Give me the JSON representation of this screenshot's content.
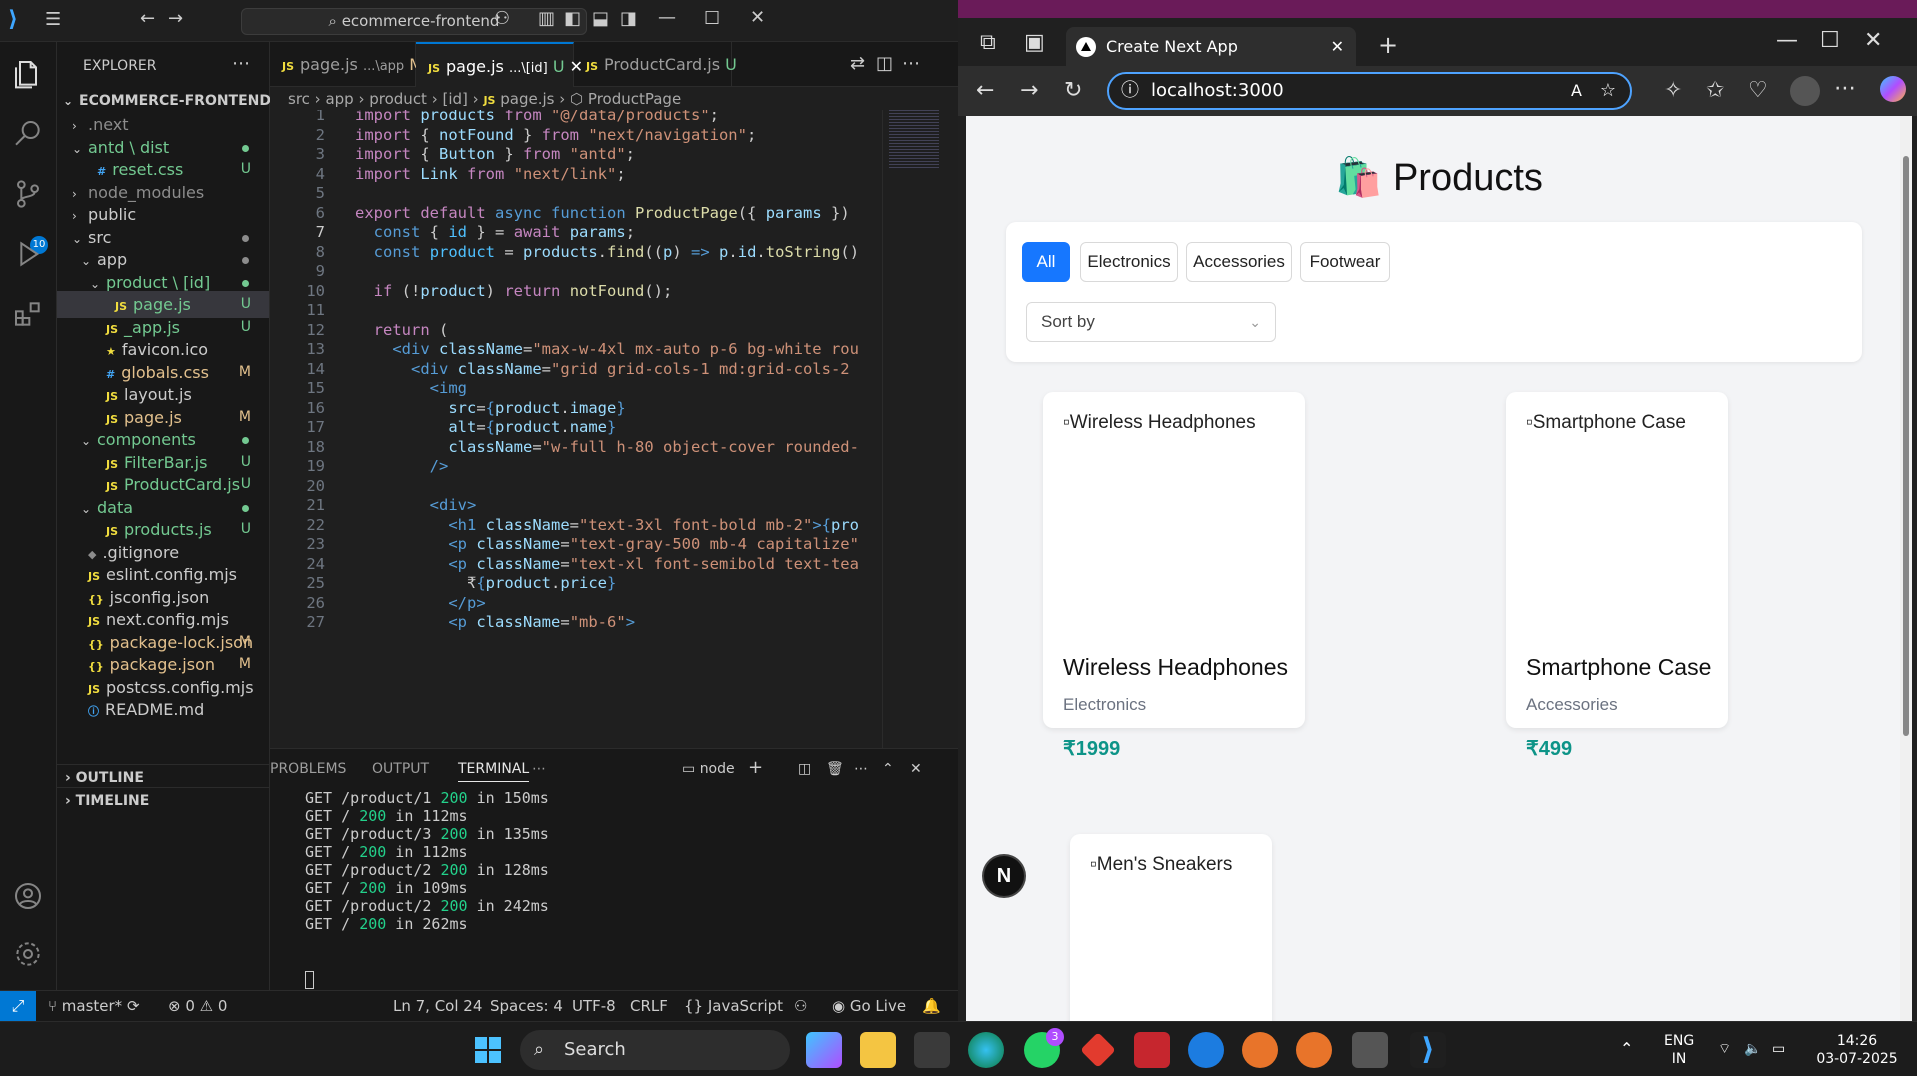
{
  "vscode": {
    "search_text": "ecommerce-frontend",
    "explorer_title": "EXPLORER",
    "project_name": "ECOMMERCE-FRONTEND",
    "scm_badge": "10",
    "tree": [
      {
        "label": ".next",
        "depth": 1,
        "type": "folder",
        "open": false,
        "status": "",
        "color": "grey"
      },
      {
        "label": "antd \\ dist",
        "depth": 1,
        "type": "folder",
        "open": true,
        "status": "dot",
        "color": "green"
      },
      {
        "label": "reset.css",
        "depth": 2,
        "type": "css",
        "status": "U",
        "color": "green"
      },
      {
        "label": "node_modules",
        "depth": 1,
        "type": "folder",
        "open": false,
        "status": "",
        "color": "grey"
      },
      {
        "label": "public",
        "depth": 1,
        "type": "folder",
        "open": false,
        "status": "",
        "color": "normal"
      },
      {
        "label": "src",
        "depth": 1,
        "type": "folder",
        "open": true,
        "status": "dot",
        "color": "normal"
      },
      {
        "label": "app",
        "depth": 2,
        "type": "folder",
        "open": true,
        "status": "dot",
        "color": "normal"
      },
      {
        "label": "product \\ [id]",
        "depth": 3,
        "type": "folder",
        "open": true,
        "status": "dot",
        "color": "green"
      },
      {
        "label": "page.js",
        "depth": 4,
        "type": "js",
        "status": "U",
        "color": "green",
        "selected": true
      },
      {
        "label": "_app.js",
        "depth": 3,
        "type": "js",
        "status": "U",
        "color": "green"
      },
      {
        "label": "favicon.ico",
        "depth": 3,
        "type": "ico",
        "status": "",
        "color": "normal"
      },
      {
        "label": "globals.css",
        "depth": 3,
        "type": "css",
        "status": "M",
        "color": "yellow"
      },
      {
        "label": "layout.js",
        "depth": 3,
        "type": "js",
        "status": "",
        "color": "normal"
      },
      {
        "label": "page.js",
        "depth": 3,
        "type": "js",
        "status": "M",
        "color": "yellow"
      },
      {
        "label": "components",
        "depth": 2,
        "type": "folder",
        "open": true,
        "status": "dot",
        "color": "green"
      },
      {
        "label": "FilterBar.js",
        "depth": 3,
        "type": "js",
        "status": "U",
        "color": "green"
      },
      {
        "label": "ProductCard.js",
        "depth": 3,
        "type": "js",
        "status": "U",
        "color": "green"
      },
      {
        "label": "data",
        "depth": 2,
        "type": "folder",
        "open": true,
        "status": "dot",
        "color": "green"
      },
      {
        "label": "products.js",
        "depth": 3,
        "type": "js",
        "status": "U",
        "color": "green"
      },
      {
        "label": ".gitignore",
        "depth": 1,
        "type": "git",
        "status": "",
        "color": "normal"
      },
      {
        "label": "eslint.config.mjs",
        "depth": 1,
        "type": "js",
        "status": "",
        "color": "normal"
      },
      {
        "label": "jsconfig.json",
        "depth": 1,
        "type": "json",
        "status": "",
        "color": "normal"
      },
      {
        "label": "next.config.mjs",
        "depth": 1,
        "type": "js",
        "status": "",
        "color": "normal"
      },
      {
        "label": "package-lock.json",
        "depth": 1,
        "type": "json",
        "status": "M",
        "color": "yellow"
      },
      {
        "label": "package.json",
        "depth": 1,
        "type": "json",
        "status": "M",
        "color": "yellow"
      },
      {
        "label": "postcss.config.mjs",
        "depth": 1,
        "type": "js",
        "status": "",
        "color": "normal"
      },
      {
        "label": "README.md",
        "depth": 1,
        "type": "info",
        "status": "",
        "color": "normal"
      }
    ],
    "outline_label": "OUTLINE",
    "timeline_label": "TIMELINE",
    "tabs": [
      {
        "name": "page.js",
        "path": "...\\app",
        "status": "M",
        "active": false
      },
      {
        "name": "page.js",
        "path": "...\\[id]",
        "status": "U",
        "active": true
      },
      {
        "name": "ProductCard.js",
        "path": "",
        "status": "U",
        "active": false
      }
    ],
    "breadcrumb": [
      "src",
      "app",
      "product",
      "[id]",
      "page.js",
      "ProductPage"
    ],
    "code_lines": [
      "1",
      "2",
      "3",
      "4",
      "5",
      "6",
      "7",
      "8",
      "9",
      "10",
      "11",
      "12",
      "13",
      "14",
      "15",
      "16",
      "17",
      "18",
      "19",
      "20",
      "21",
      "22",
      "23",
      "24",
      "25",
      "26",
      "27"
    ],
    "panel_tabs": [
      "PROBLEMS",
      "OUTPUT",
      "TERMINAL"
    ],
    "terminal_shell": "node",
    "terminal": [
      {
        "path": "GET /product/1 ",
        "code": "200",
        "time": " in 150ms"
      },
      {
        "path": "GET / ",
        "code": "200",
        "time": " in 112ms"
      },
      {
        "path": "GET /product/3 ",
        "code": "200",
        "time": " in 135ms"
      },
      {
        "path": "GET / ",
        "code": "200",
        "time": " in 112ms"
      },
      {
        "path": "GET /product/2 ",
        "code": "200",
        "time": " in 128ms"
      },
      {
        "path": "GET / ",
        "code": "200",
        "time": " in 109ms"
      },
      {
        "path": "GET /product/2 ",
        "code": "200",
        "time": " in 242ms"
      },
      {
        "path": "GET / ",
        "code": "200",
        "time": " in 262ms"
      }
    ],
    "status": {
      "branch": "master*",
      "errors": "0",
      "warnings": "0",
      "position": "Ln 7, Col 24",
      "spaces": "Spaces: 4",
      "encoding": "UTF-8",
      "eol": "CRLF",
      "language": "JavaScript",
      "golive": "Go Live"
    }
  },
  "browser": {
    "tab_title": "Create Next App",
    "url": "localhost:3000",
    "page": {
      "heading_emoji": "🛍️",
      "heading": "Products",
      "filters": [
        "All",
        "Electronics",
        "Accessories",
        "Footwear"
      ],
      "active_filter": "All",
      "sort_placeholder": "Sort by",
      "products": [
        {
          "alt": "Wireless Headphones",
          "name": "Wireless Headphones",
          "category": "Electronics",
          "price": "₹1999"
        },
        {
          "alt": "Smartphone Case",
          "name": "Smartphone Case",
          "category": "Accessories",
          "price": "₹499"
        },
        {
          "alt": "Men's Sneakers",
          "name": "",
          "category": "",
          "price": ""
        }
      ],
      "next_badge": "N"
    }
  },
  "taskbar": {
    "search_label": "Search",
    "whatsapp_badge": "3",
    "lang_top": "ENG",
    "lang_bottom": "IN",
    "time": "14:26",
    "date": "03-07-2025"
  }
}
